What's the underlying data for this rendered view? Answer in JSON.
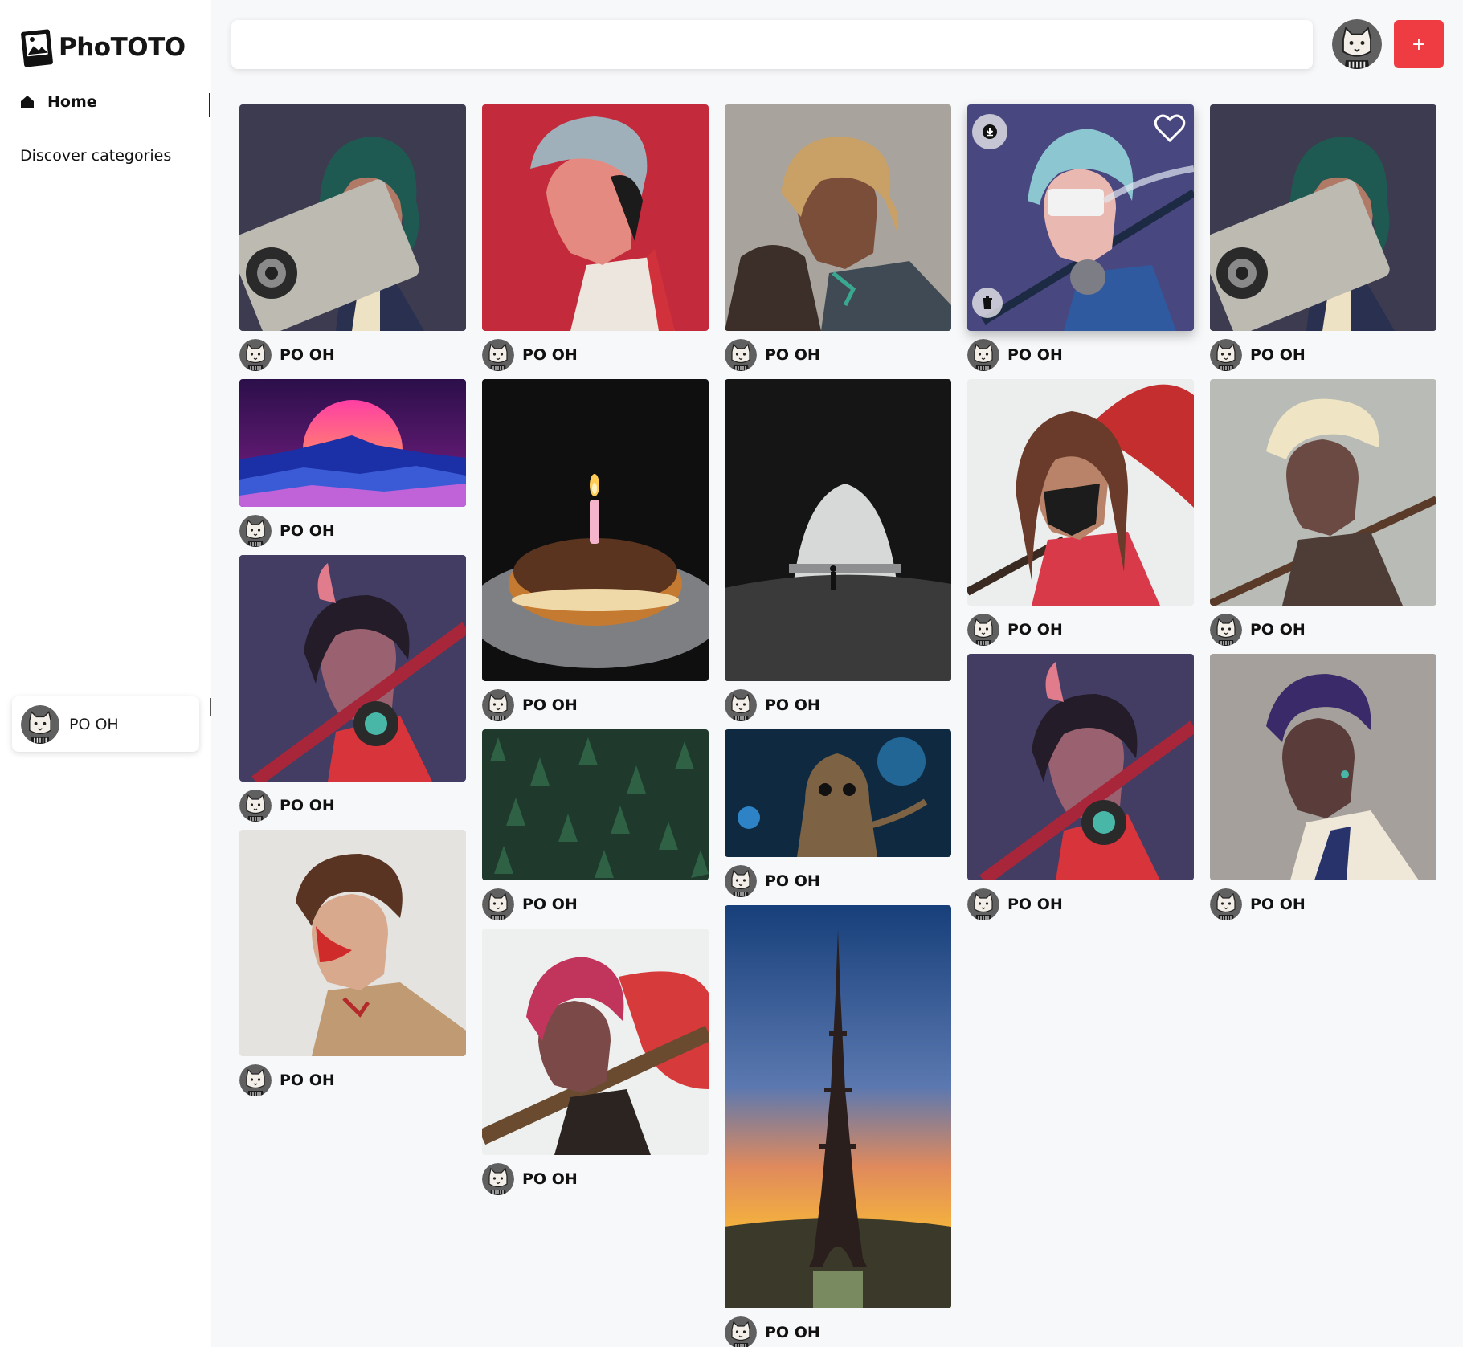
{
  "app": {
    "name": "PhoTOTO"
  },
  "sidebar": {
    "items": [
      {
        "label": "Home",
        "icon": "home-icon",
        "active": true
      },
      {
        "label": "Discover categories",
        "icon": "",
        "active": false
      }
    ],
    "profile": {
      "label": "PO OH",
      "icon": "avatar"
    }
  },
  "header": {
    "search": {
      "value": "",
      "placeholder": ""
    },
    "add_button_label": "+",
    "add_button_color": "#ef3c43"
  },
  "feed": {
    "author_label": "PO OH",
    "hovered_pin_actions": [
      "download-icon",
      "heart-icon",
      "trash-icon"
    ],
    "columns": [
      [
        {
          "subject": "green-haired anime boy with boombox",
          "author": "PO OH"
        },
        {
          "subject": "synthwave sunset over mountains",
          "author": "PO OH"
        },
        {
          "subject": "horned anime boy with bat and headphones",
          "author": "PO OH"
        },
        {
          "subject": "anime boy with kabuki face paint",
          "author": "PO OH"
        }
      ],
      [
        {
          "subject": "silver-haired anime boy on red background",
          "author": "PO OH"
        },
        {
          "subject": "donut with birthday candle",
          "author": "PO OH"
        },
        {
          "subject": "aerial pine forest",
          "author": "PO OH"
        },
        {
          "subject": "pink-haired anime boy with guitar",
          "author": "PO OH"
        }
      ],
      [
        {
          "subject": "blond anime boy with folding fan",
          "author": "PO OH"
        },
        {
          "subject": "person in sea cave",
          "author": "PO OH"
        },
        {
          "subject": "baby groot",
          "author": "PO OH"
        },
        {
          "subject": "eiffel tower at sunset",
          "author": "PO OH"
        }
      ],
      [
        {
          "subject": "blue-haired anime girl with sword",
          "author": "PO OH"
        },
        {
          "subject": "anime girl with mask and red umbrella",
          "author": "PO OH"
        },
        {
          "subject": "horned anime boy with bat and headphones",
          "author": "PO OH"
        }
      ],
      [
        {
          "subject": "green-haired anime boy with boombox",
          "author": "PO OH"
        },
        {
          "subject": "blond anime boy with katana",
          "author": "PO OH"
        },
        {
          "subject": "purple-haired anime boy",
          "author": "PO OH"
        }
      ]
    ]
  }
}
